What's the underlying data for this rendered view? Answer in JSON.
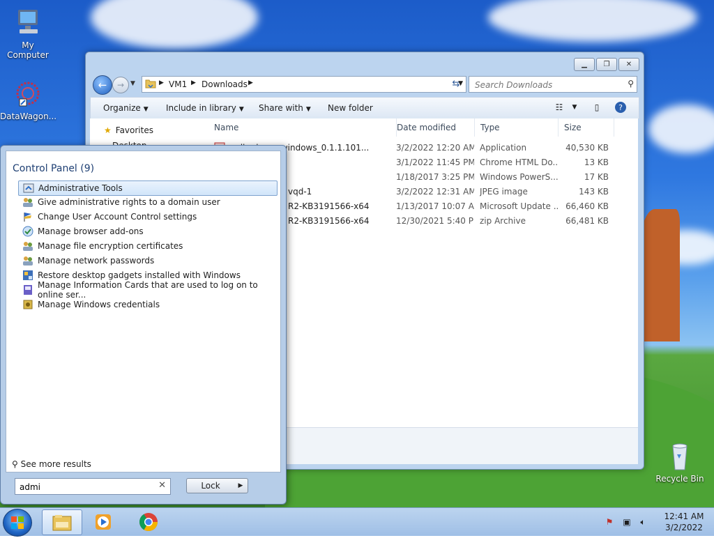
{
  "desktop": {
    "icons": [
      {
        "label": "My Computer",
        "icon": "computer-icon"
      },
      {
        "label": "DataWagon...",
        "icon": "datawagon-icon"
      },
      {
        "label": "Recycle Bin",
        "icon": "recycle-bin-icon"
      }
    ]
  },
  "explorer": {
    "address": {
      "crumbs": [
        "VM1",
        "Downloads"
      ]
    },
    "search_placeholder": "Search Downloads",
    "toolbar": {
      "organize": "Organize",
      "include_in_library": "Include in library",
      "share_with": "Share with",
      "new_folder": "New folder"
    },
    "nav": {
      "favorites": "Favorites",
      "desktop": "Desktop"
    },
    "columns": [
      "Name",
      "Date modified",
      "Type",
      "Size"
    ],
    "files": [
      {
        "name": "...dl...doom_windows_0.1.1.101...",
        "date": "3/2/2022 12:20 AM",
        "type": "Application",
        "size": "40,530 KB"
      },
      {
        "name": "",
        "date": "3/1/2022 11:45 PM",
        "type": "Chrome HTML Do...",
        "size": "13 KB"
      },
      {
        "name": "",
        "date": "1/18/2017 3:25 PM",
        "type": "Windows PowerS...",
        "size": "17 KB"
      },
      {
        "name": "vqd-1",
        "date": "3/2/2022 12:31 AM",
        "type": "JPEG image",
        "size": "143 KB"
      },
      {
        "name": "R2-KB3191566-x64",
        "date": "1/13/2017 10:07 AM",
        "type": "Microsoft Update ...",
        "size": "66,460 KB"
      },
      {
        "name": "R2-KB3191566-x64",
        "date": "12/30/2021 5:40 PM",
        "type": "zip Archive",
        "size": "66,481 KB"
      }
    ]
  },
  "startmenu": {
    "header": "Control Panel (9)",
    "items": [
      "Administrative Tools",
      "Give administrative rights to a domain user",
      "Change User Account Control settings",
      "Manage browser add-ons",
      "Manage file encryption certificates",
      "Manage network passwords",
      "Restore desktop gadgets installed with Windows",
      "Manage Information Cards that are used to log on to online ser...",
      "Manage Windows credentials"
    ],
    "see_more": "See more results",
    "search_value": "admi",
    "lock_label": "Lock"
  },
  "taskbar": {
    "time": "12:41 AM",
    "date": "3/2/2022"
  }
}
